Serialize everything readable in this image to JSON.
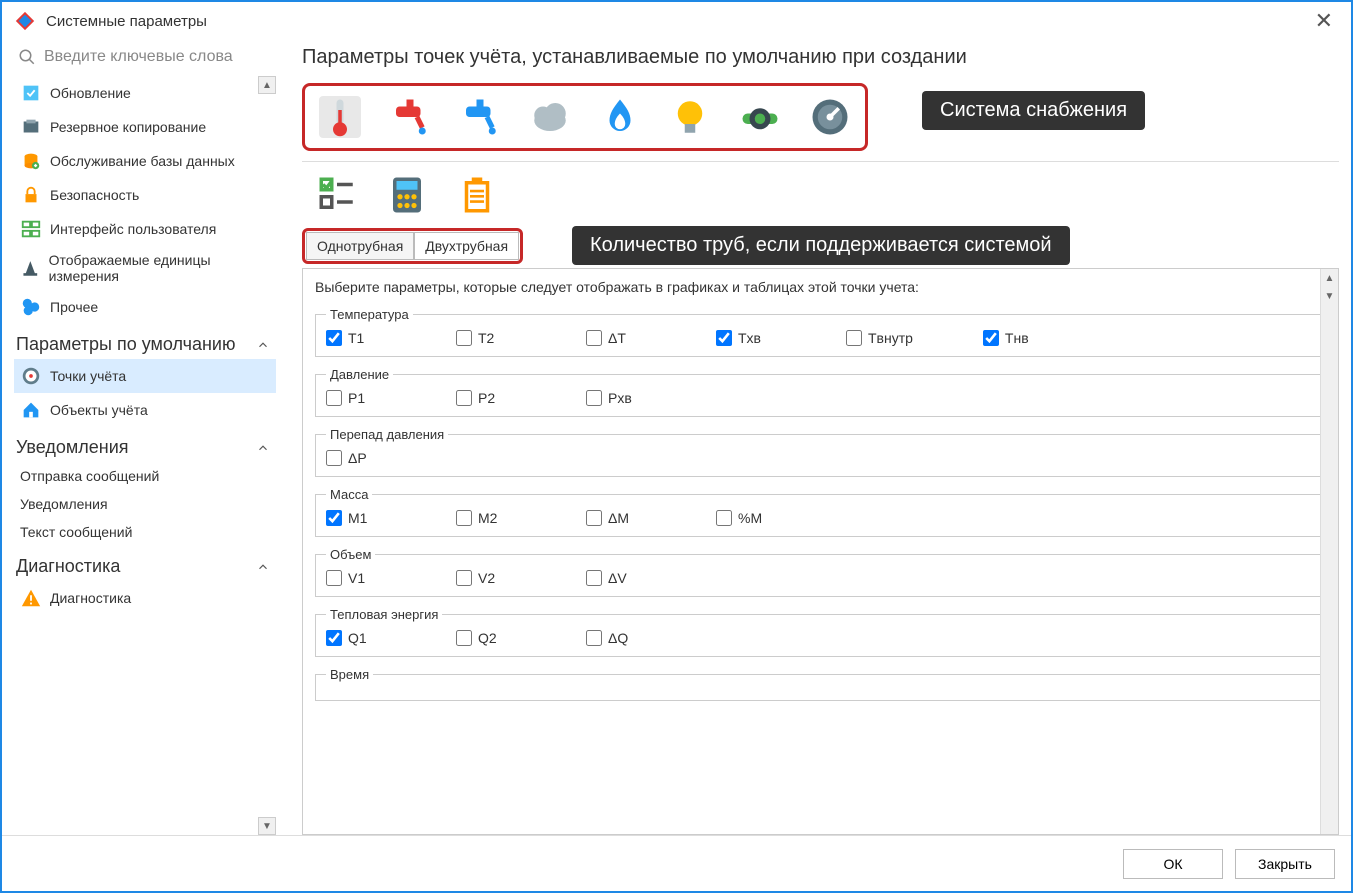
{
  "window": {
    "title": "Системные параметры"
  },
  "search": {
    "placeholder": "Введите ключевые слова"
  },
  "sidebar": {
    "group_top": [
      {
        "label": "Обновление",
        "icon": "update-icon"
      },
      {
        "label": "Резервное копирование",
        "icon": "backup-icon"
      },
      {
        "label": "Обслуживание базы данных",
        "icon": "db-icon"
      },
      {
        "label": "Безопасность",
        "icon": "lock-icon"
      },
      {
        "label": "Интерфейс пользователя",
        "icon": "ui-icon"
      },
      {
        "label": "Отображаемые единицы измерения",
        "icon": "units-icon"
      },
      {
        "label": "Прочее",
        "icon": "misc-icon"
      }
    ],
    "section_defaults": {
      "title": "Параметры по умолчанию"
    },
    "defaults_items": [
      {
        "label": "Точки учёта",
        "icon": "meter-icon",
        "selected": true
      },
      {
        "label": "Объекты учёта",
        "icon": "house-icon"
      }
    ],
    "section_notify": {
      "title": "Уведомления"
    },
    "notify_items": [
      {
        "label": "Отправка сообщений"
      },
      {
        "label": "Уведомления"
      },
      {
        "label": "Текст сообщений"
      }
    ],
    "section_diag": {
      "title": "Диагностика"
    },
    "diag_items": [
      {
        "label": "Диагностика",
        "icon": "warn-icon"
      }
    ]
  },
  "main": {
    "title": "Параметры точек учёта, устанавливаемые по умолчанию при создании",
    "supply_icons": [
      "thermometer-icon",
      "hot-tap-icon",
      "cold-tap-icon",
      "cloud-icon",
      "gas-icon",
      "bulb-icon",
      "sewage-icon",
      "gauge-icon"
    ],
    "callout_supply": "Система снабжения",
    "mode_icons": [
      "checklist-icon",
      "calc-icon",
      "clipboard-icon"
    ],
    "tabs": [
      "Однотрубная",
      "Двухтрубная"
    ],
    "callout_tabs": "Количество труб, если поддерживается системой",
    "intro": "Выберите параметры, которые следует отображать в графиках и таблицах этой точки учета:",
    "groups": [
      {
        "title": "Температура",
        "items": [
          {
            "label": "T1",
            "checked": true
          },
          {
            "label": "T2",
            "checked": false
          },
          {
            "label": "ΔT",
            "checked": false
          },
          {
            "label": "Tхв",
            "checked": true
          },
          {
            "label": "Tвнутр",
            "checked": false
          },
          {
            "label": "Tнв",
            "checked": true
          }
        ]
      },
      {
        "title": "Давление",
        "items": [
          {
            "label": "P1",
            "checked": false
          },
          {
            "label": "P2",
            "checked": false
          },
          {
            "label": "Pхв",
            "checked": false
          }
        ]
      },
      {
        "title": "Перепад давления",
        "items": [
          {
            "label": "ΔP",
            "checked": false
          }
        ]
      },
      {
        "title": "Масса",
        "items": [
          {
            "label": "M1",
            "checked": true
          },
          {
            "label": "M2",
            "checked": false
          },
          {
            "label": "ΔM",
            "checked": false
          },
          {
            "label": "%M",
            "checked": false
          }
        ]
      },
      {
        "title": "Объем",
        "items": [
          {
            "label": "V1",
            "checked": false
          },
          {
            "label": "V2",
            "checked": false
          },
          {
            "label": "ΔV",
            "checked": false
          }
        ]
      },
      {
        "title": "Тепловая энергия",
        "items": [
          {
            "label": "Q1",
            "checked": true
          },
          {
            "label": "Q2",
            "checked": false
          },
          {
            "label": "ΔQ",
            "checked": false
          }
        ]
      },
      {
        "title": "Время",
        "items": []
      }
    ]
  },
  "footer": {
    "ok": "ОК",
    "close": "Закрыть"
  }
}
